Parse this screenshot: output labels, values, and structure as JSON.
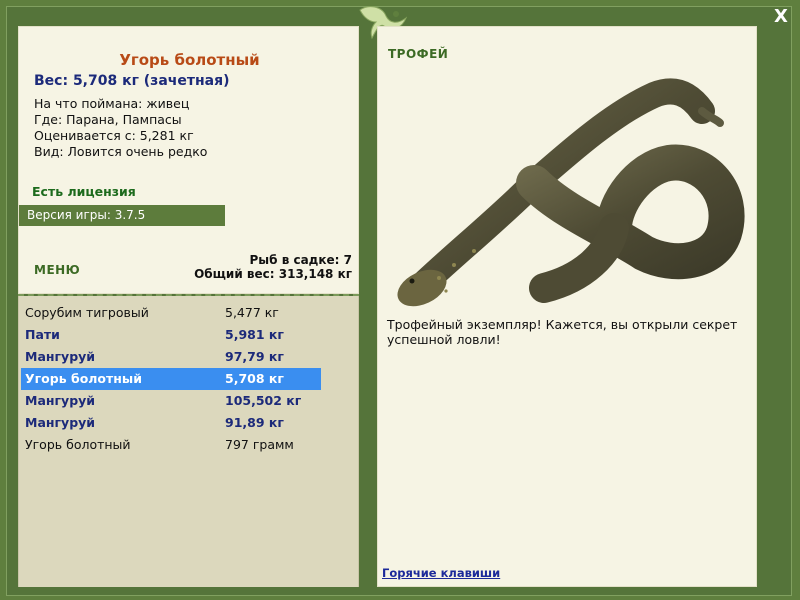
{
  "window": {
    "close_glyph": "X"
  },
  "fish": {
    "name": "Угорь болотный",
    "weight_line": "Вес: 5,708 кг (зачетная)",
    "details": [
      "На что поймана: живец",
      "Где: Парана, Пампасы",
      "Оценивается с: 5,281 кг",
      "Вид: Ловится очень редко"
    ]
  },
  "license": "Есть лицензия",
  "version": "Версия игры: 3.7.5",
  "menu_label": "МЕНЮ",
  "sadok": {
    "count_line": "Рыб в садке: 7",
    "total_line": "Общий вес: 313,148 кг"
  },
  "catch_list": [
    {
      "name": "Сорубим тигровый",
      "weight": "5,477 кг",
      "style": "plain"
    },
    {
      "name": "Пати",
      "weight": "5,981 кг",
      "style": "bold"
    },
    {
      "name": "Мангуруй",
      "weight": "97,79 кг",
      "style": "bold"
    },
    {
      "name": "Угорь болотный",
      "weight": "5,708 кг",
      "style": "selected"
    },
    {
      "name": "Мангуруй",
      "weight": "105,502 кг",
      "style": "bold"
    },
    {
      "name": "Мангуруй",
      "weight": "91,89 кг",
      "style": "bold"
    },
    {
      "name": "Угорь болотный",
      "weight": "797 грамм",
      "style": "plain"
    }
  ],
  "trophy": {
    "title": "ТРОФЕЙ",
    "text": "Трофейный экземпляр! Кажется, вы открыли секрет успешной ловли!",
    "image_icon": "eel-image"
  },
  "hotkeys_label": "Горячие клавиши",
  "colors": {
    "frame": "#5f7f3e",
    "panel": "#f6f4e4",
    "list_bg": "#dcd8bd",
    "selected": "#3a8ef0",
    "fish_name": "#b84a16",
    "heading_green": "#3c6a24"
  }
}
